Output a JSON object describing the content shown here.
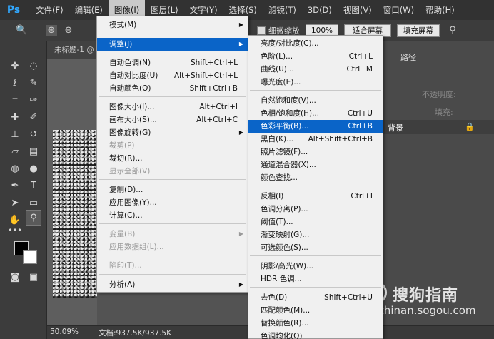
{
  "app": {
    "logo": "Ps"
  },
  "menubar": {
    "items": [
      "文件(F)",
      "编辑(E)",
      "图像(I)",
      "图层(L)",
      "文字(Y)",
      "选择(S)",
      "滤镜(T)",
      "3D(D)",
      "视图(V)",
      "窗口(W)",
      "帮助(H)"
    ],
    "active_index": 2
  },
  "options_bar": {
    "scrubby_zoom_label": "细微缩放",
    "zoom_btn": "100%",
    "fit_btn": "适合屏幕",
    "fill_btn": "填充屏幕"
  },
  "document": {
    "tab_title": "未标题-1 @",
    "zoom_readout": "50.09%",
    "doc_size": "文档:937.5K/937.5K"
  },
  "right_panel": {
    "path_tab": "路径",
    "opacity_label": "不透明度:",
    "fill_label": "填充:",
    "layer_name": "背景"
  },
  "watermark": {
    "logo_glyph": "S",
    "brand": "搜狗指南",
    "url": "zhinan.sogou.com"
  },
  "image_menu": {
    "items": [
      {
        "label": "模式(M)",
        "shortcut": "",
        "submenu": true,
        "disabled": false
      },
      {
        "label": "调整(J)",
        "shortcut": "",
        "submenu": true,
        "disabled": false
      },
      {
        "label": "自动色调(N)",
        "shortcut": "Shift+Ctrl+L",
        "submenu": false,
        "disabled": false
      },
      {
        "label": "自动对比度(U)",
        "shortcut": "Alt+Shift+Ctrl+L",
        "submenu": false,
        "disabled": false
      },
      {
        "label": "自动颜色(O)",
        "shortcut": "Shift+Ctrl+B",
        "submenu": false,
        "disabled": false
      },
      {
        "label": "图像大小(I)...",
        "shortcut": "Alt+Ctrl+I",
        "submenu": false,
        "disabled": false
      },
      {
        "label": "画布大小(S)...",
        "shortcut": "Alt+Ctrl+C",
        "submenu": false,
        "disabled": false
      },
      {
        "label": "图像旋转(G)",
        "shortcut": "",
        "submenu": true,
        "disabled": false
      },
      {
        "label": "裁剪(P)",
        "shortcut": "",
        "submenu": false,
        "disabled": true
      },
      {
        "label": "裁切(R)...",
        "shortcut": "",
        "submenu": false,
        "disabled": false
      },
      {
        "label": "显示全部(V)",
        "shortcut": "",
        "submenu": false,
        "disabled": true
      },
      {
        "label": "复制(D)...",
        "shortcut": "",
        "submenu": false,
        "disabled": false
      },
      {
        "label": "应用图像(Y)...",
        "shortcut": "",
        "submenu": false,
        "disabled": false
      },
      {
        "label": "计算(C)...",
        "shortcut": "",
        "submenu": false,
        "disabled": false
      },
      {
        "label": "变量(B)",
        "shortcut": "",
        "submenu": true,
        "disabled": true
      },
      {
        "label": "应用数据组(L)...",
        "shortcut": "",
        "submenu": false,
        "disabled": true
      },
      {
        "label": "陷印(T)...",
        "shortcut": "",
        "submenu": false,
        "disabled": true
      },
      {
        "label": "分析(A)",
        "shortcut": "",
        "submenu": true,
        "disabled": false
      }
    ]
  },
  "adjust_menu": {
    "items": [
      {
        "label": "亮度/对比度(C)...",
        "shortcut": ""
      },
      {
        "label": "色阶(L)...",
        "shortcut": "Ctrl+L"
      },
      {
        "label": "曲线(U)...",
        "shortcut": "Ctrl+M"
      },
      {
        "label": "曝光度(E)...",
        "shortcut": ""
      },
      {
        "label": "自然饱和度(V)...",
        "shortcut": ""
      },
      {
        "label": "色相/饱和度(H)...",
        "shortcut": "Ctrl+U"
      },
      {
        "label": "色彩平衡(B)...",
        "shortcut": "Ctrl+B"
      },
      {
        "label": "黑白(K)...",
        "shortcut": "Alt+Shift+Ctrl+B"
      },
      {
        "label": "照片滤镜(F)...",
        "shortcut": ""
      },
      {
        "label": "通道混合器(X)...",
        "shortcut": ""
      },
      {
        "label": "颜色查找...",
        "shortcut": ""
      },
      {
        "label": "反相(I)",
        "shortcut": "Ctrl+I"
      },
      {
        "label": "色调分离(P)...",
        "shortcut": ""
      },
      {
        "label": "阈值(T)...",
        "shortcut": ""
      },
      {
        "label": "渐变映射(G)...",
        "shortcut": ""
      },
      {
        "label": "可选颜色(S)...",
        "shortcut": ""
      },
      {
        "label": "阴影/高光(W)...",
        "shortcut": ""
      },
      {
        "label": "HDR 色调...",
        "shortcut": ""
      },
      {
        "label": "去色(D)",
        "shortcut": "Shift+Ctrl+U"
      },
      {
        "label": "匹配颜色(M)...",
        "shortcut": ""
      },
      {
        "label": "替换颜色(R)...",
        "shortcut": ""
      },
      {
        "label": "色调均化(Q)",
        "shortcut": ""
      }
    ]
  },
  "colors": {
    "highlight": "#0a64c8",
    "foreground": "#000000",
    "background": "#ffffff"
  }
}
